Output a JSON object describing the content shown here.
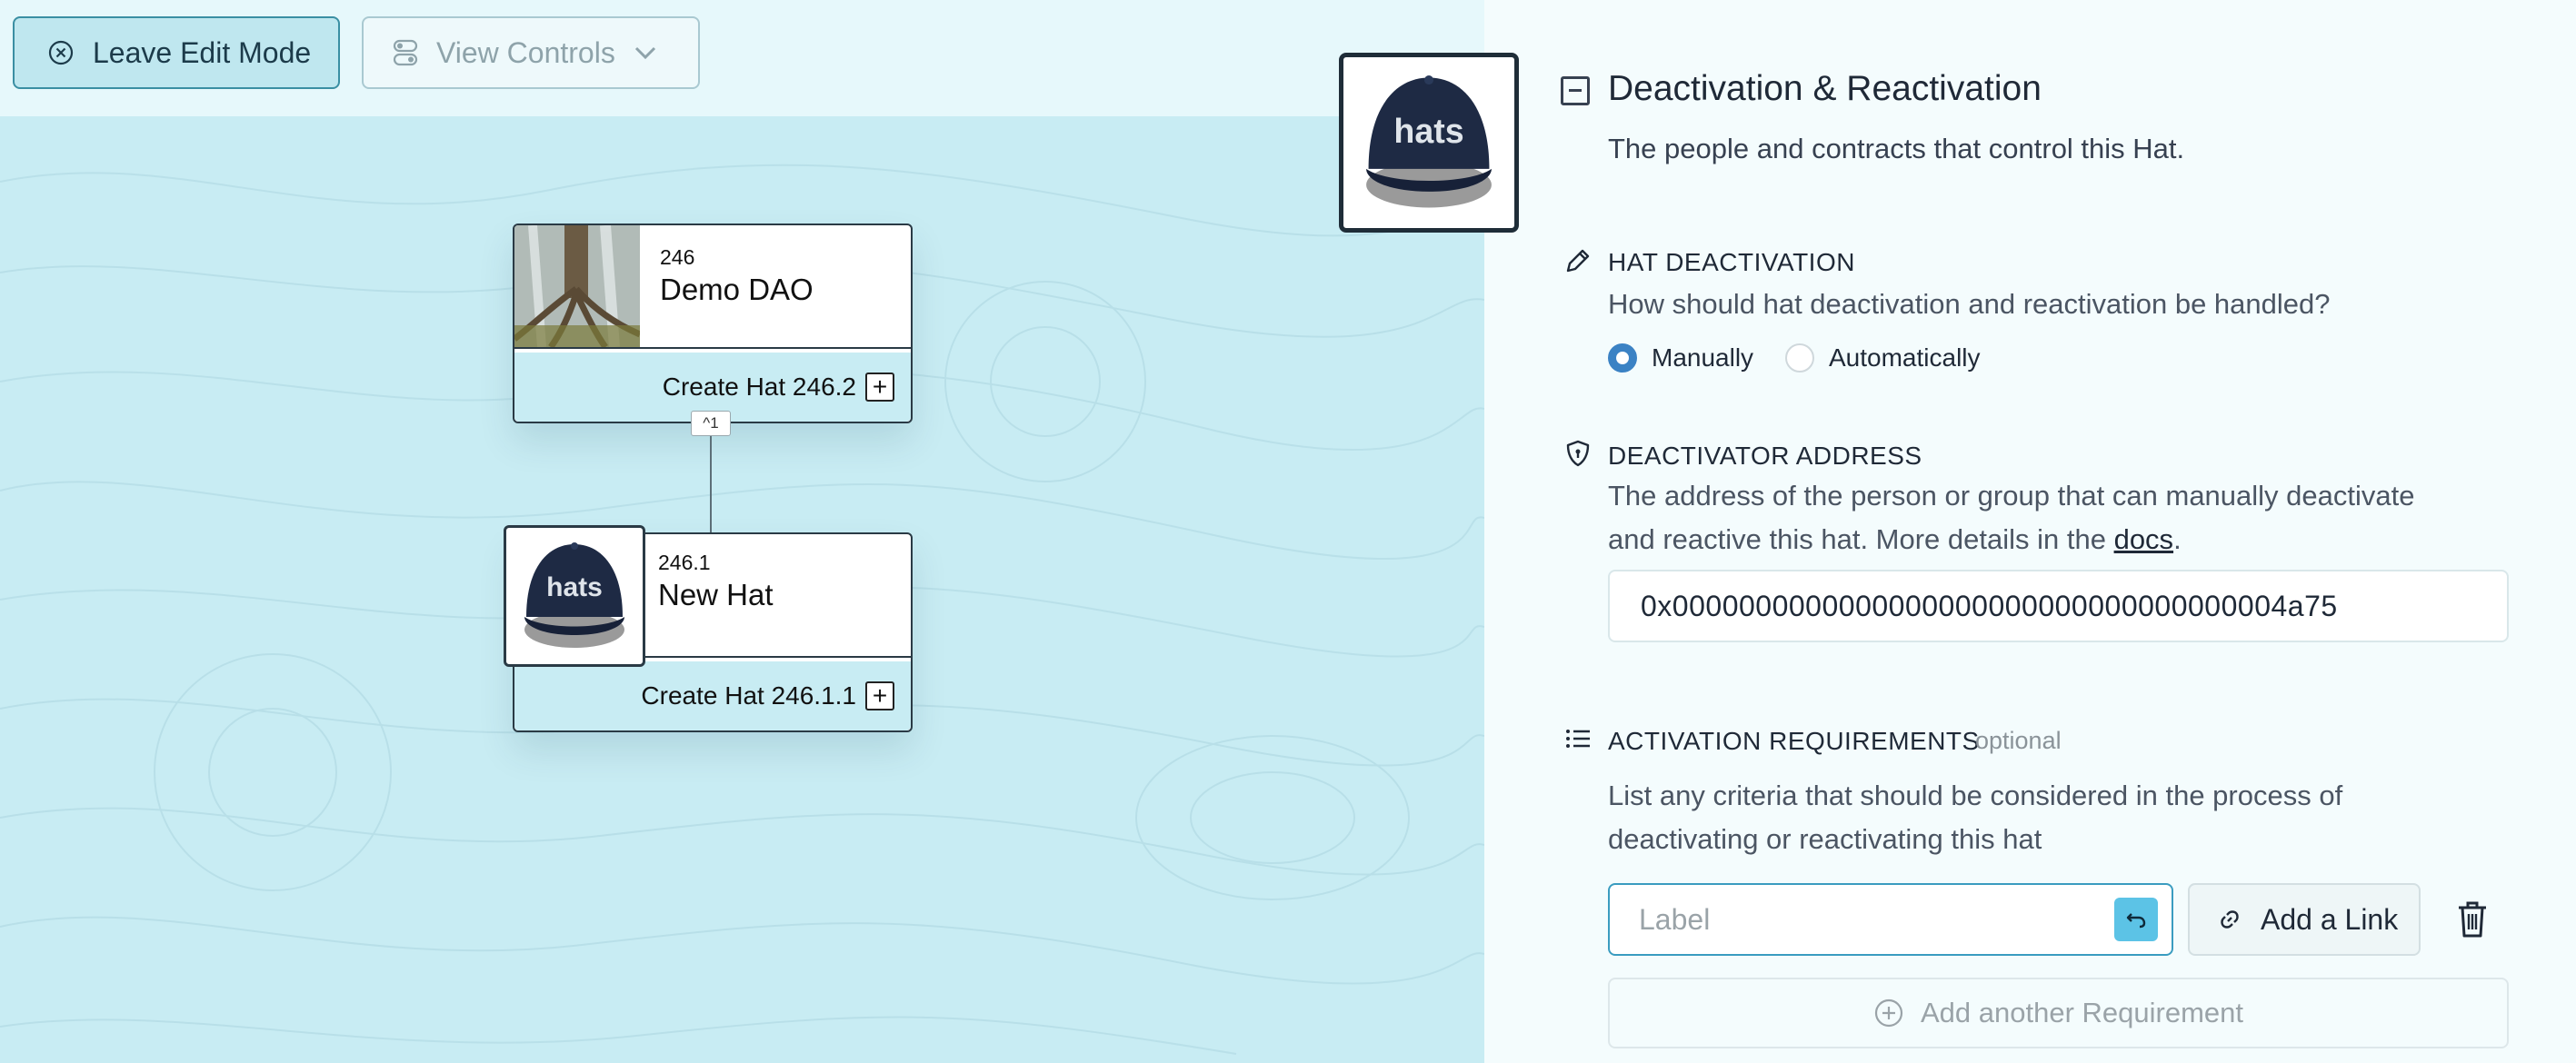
{
  "toolbar": {
    "leave_edit_label": "Leave Edit Mode",
    "view_controls_label": "View Controls"
  },
  "tree": {
    "root": {
      "id": "246",
      "name": "Demo DAO",
      "create_label": "Create Hat 246.2"
    },
    "connector_badge": "^1",
    "child": {
      "id": "246.1",
      "name": "New Hat",
      "create_label": "Create Hat 246.1.1"
    }
  },
  "hat_image_text": "hats",
  "panel": {
    "title": "Deactivation & Reactivation",
    "subtitle": "The people and contracts that control this Hat.",
    "hat_deactivation": {
      "label": "HAT DEACTIVATION",
      "question": "How should hat deactivation and reactivation be handled?",
      "options": [
        "Manually",
        "Automatically"
      ],
      "selected": "Manually"
    },
    "deactivator": {
      "label": "DEACTIVATOR ADDRESS",
      "desc_line1": "The address of the person or group that can manually deactivate",
      "desc_line2_pre": "and reactive this hat. More details in the ",
      "docs_link": "docs",
      "desc_line2_post": ".",
      "value": "0x0000000000000000000000000000000000004a75"
    },
    "activation": {
      "label": "ACTIVATION REQUIREMENTS",
      "optional": "optional",
      "desc_line1": "List any criteria that should be considered in the process of",
      "desc_line2": "deactivating or reactivating this hat",
      "label_placeholder": "Label",
      "add_link_label": "Add a Link",
      "add_another_label": "Add another Requirement"
    }
  },
  "colors": {
    "canvas_bg": "#c8ecf3",
    "panel_bg": "#f4fcfd",
    "accent": "#3b82c4",
    "undo_btn": "#5cc3e6"
  }
}
